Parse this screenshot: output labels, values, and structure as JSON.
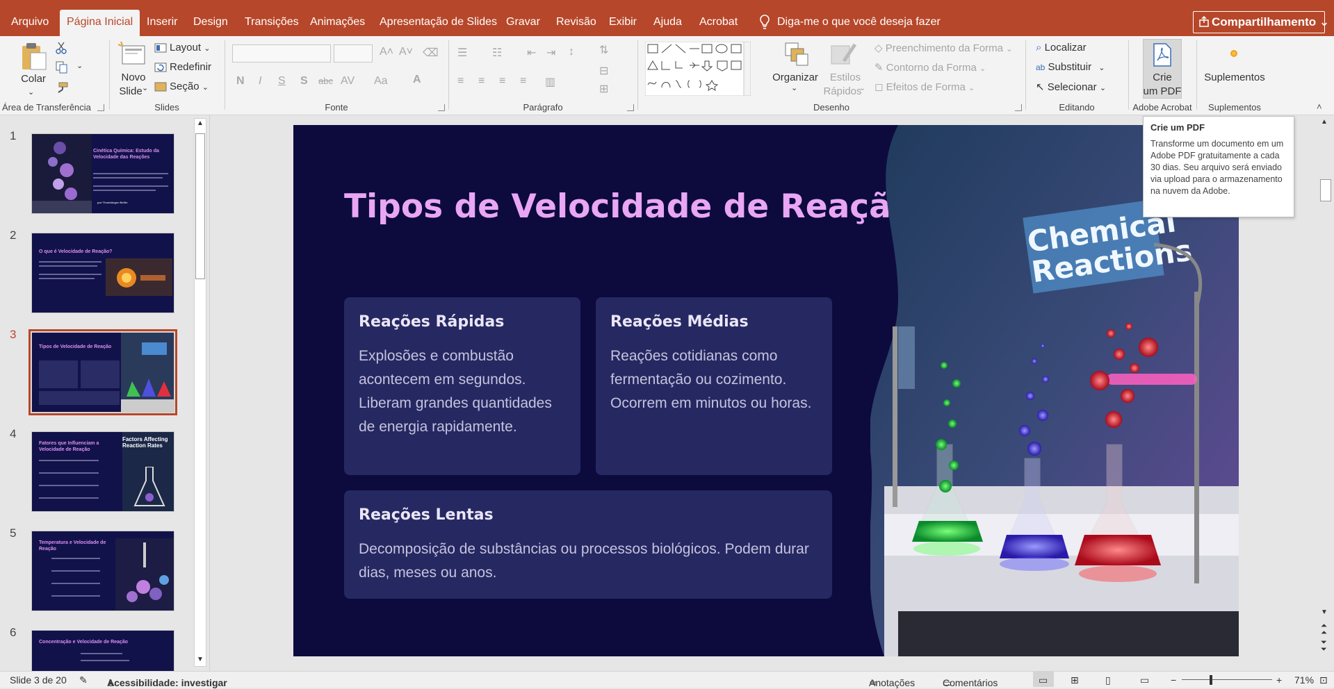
{
  "menu": {
    "tabs": [
      "Arquivo",
      "Página Inicial",
      "Inserir",
      "Design",
      "Transições",
      "Animações",
      "Apresentação de Slides",
      "Gravar",
      "Revisão",
      "Exibir",
      "Ajuda",
      "Acrobat"
    ],
    "active_tab": "Página Inicial",
    "tellme": "Diga-me o que você deseja fazer",
    "share": "Compartilhamento"
  },
  "ribbon": {
    "clipboard": {
      "paste": "Colar",
      "label": "Área de Transferência"
    },
    "slides": {
      "new_slide_1": "Novo",
      "new_slide_2": "Slide",
      "layout": "Layout",
      "reset": "Redefinir",
      "section": "Seção",
      "label": "Slides"
    },
    "font": {
      "label": "Fonte",
      "bold": "N",
      "italic": "I",
      "underline": "S",
      "shadow": "S",
      "strike": "abc",
      "spacing": "AV",
      "case": "Aa",
      "color": "A"
    },
    "paragraph": {
      "label": "Parágrafo"
    },
    "drawing": {
      "arrange": "Organizar",
      "quick_styles_1": "Estilos",
      "quick_styles_2": "Rápidos",
      "fill": "Preenchimento da Forma",
      "outline": "Contorno da Forma",
      "effects": "Efeitos de Forma",
      "label": "Desenho"
    },
    "editing": {
      "find": "Localizar",
      "replace": "Substituir",
      "select": "Selecionar",
      "label": "Editando"
    },
    "acrobat": {
      "create_pdf_1": "Crie",
      "create_pdf_2": "um PDF",
      "label": "Adobe Acrobat"
    },
    "addins": {
      "addins": "Suplementos",
      "label": "Suplementos"
    }
  },
  "thumbnails": [
    {
      "num": "1",
      "title": "Cinética Química: Estudo da Velocidade das Reações",
      "author": "por Thomidogen Bellin"
    },
    {
      "num": "2",
      "title": "O que é Velocidade de Reação?"
    },
    {
      "num": "3",
      "title": "Tipos de Velocidade de Reação",
      "selected": true
    },
    {
      "num": "4",
      "title": "Fatores que Influenciam a Velocidade de Reação",
      "image_text": "Factors Affecting Reaction Rates"
    },
    {
      "num": "5",
      "title": "Temperatura e Velocidade de Reação"
    },
    {
      "num": "6",
      "title": "Concentração e Velocidade de Reação"
    }
  ],
  "slide": {
    "title": "Tipos de Velocidade de Reação",
    "cards": [
      {
        "heading": "Reações Rápidas",
        "body": "Explosões e combustão acontecem em segundos. Liberam grandes quantidades de energia rapidamente."
      },
      {
        "heading": "Reações Médias",
        "body": "Reações cotidianas como fermentação ou cozimento. Ocorrem em minutos ou horas."
      },
      {
        "heading": "Reações Lentas",
        "body": "Decomposição de substâncias ou processos biológicos. Podem durar dias, meses ou anos."
      }
    ],
    "image_sign": [
      "Chemical",
      "Reactions"
    ],
    "colors": {
      "background": "#0d0b3e",
      "title": "#e9a6f4",
      "card": "#262862"
    }
  },
  "tooltip": {
    "title": "Crie um PDF",
    "body": "Transforme um documento em um Adobe PDF gratuitamente a cada 30 dias. Seu arquivo será enviado via upload para o armazenamento na nuvem da Adobe."
  },
  "status": {
    "slide_count": "Slide 3 de 20",
    "accessibility": "Acessibilidade: investigar",
    "notes": "Anotações",
    "comments": "Comentários",
    "zoom": "71%"
  }
}
